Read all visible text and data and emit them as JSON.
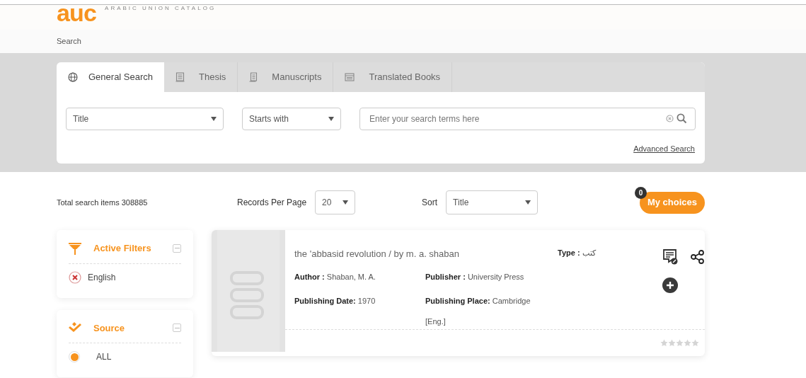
{
  "header": {
    "logo": "auc",
    "tagline": "ARABIC UNION CATALOG"
  },
  "breadcrumb": "Search",
  "tabs": [
    {
      "kind": "globe",
      "label": "General Search",
      "selected": true
    },
    {
      "kind": "thesis",
      "label": "Thesis",
      "selected": false
    },
    {
      "kind": "manuscript",
      "label": "Manuscripts",
      "selected": false
    },
    {
      "kind": "book",
      "label": "Translated Books",
      "selected": false
    }
  ],
  "search": {
    "field": "Title",
    "match": "Starts with",
    "placeholder": "Enter your search terms here",
    "advanced_link": "Advanced Search"
  },
  "toolbar": {
    "total": "Total search items 308885",
    "records_label": "Records Per Page",
    "records_value": "20",
    "sort_label": "Sort",
    "sort_value": "Title",
    "choices_button": "My choices",
    "choices_count": "0"
  },
  "sidebar": [
    {
      "kind": "filters",
      "title": "Active Filters",
      "expanded": true,
      "items": [
        {
          "label": "English"
        }
      ]
    },
    {
      "kind": "source",
      "title": "Source",
      "expanded": true,
      "items": [
        {
          "label": "ALL",
          "selected": true
        }
      ]
    }
  ],
  "results": [
    {
      "title": "the 'abbasid revolution / by m. a. shaban",
      "type_label": "Type :",
      "type_value": "كتب",
      "fields": [
        {
          "label": "Author :",
          "value": "Shaban, M. A."
        },
        {
          "label": "Publisher :",
          "value": "University Press"
        },
        {
          "label": "Publishing Date:",
          "value": "1970"
        },
        {
          "label": "Publishing Place:",
          "value": "Cambridge"
        }
      ],
      "note": "[Eng.]",
      "stars": 0
    }
  ]
}
